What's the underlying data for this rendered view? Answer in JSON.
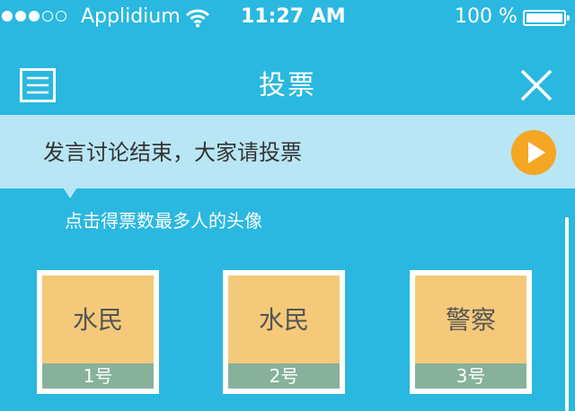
{
  "status_bar": {
    "carrier": "Applidium",
    "time": "11:27 AM",
    "battery": "100 %"
  },
  "nav": {
    "title": "投票"
  },
  "banner": {
    "text": "发言讨论结束，大家请投票"
  },
  "instruction": "点击得票数最多人的头像",
  "players": [
    {
      "role": "水民",
      "number": "1号"
    },
    {
      "role": "水民",
      "number": "2号"
    },
    {
      "role": "警察",
      "number": "3号"
    }
  ],
  "colors": {
    "background": "#2ab8e0",
    "banner": "#b9e6f4",
    "play_button": "#f5a623",
    "card_face": "#f5c97a",
    "card_label": "#87b19b"
  },
  "icons": {
    "menu": "menu-icon",
    "close": "close-icon",
    "play": "play-icon",
    "wifi": "wifi-icon",
    "battery": "battery-icon"
  }
}
